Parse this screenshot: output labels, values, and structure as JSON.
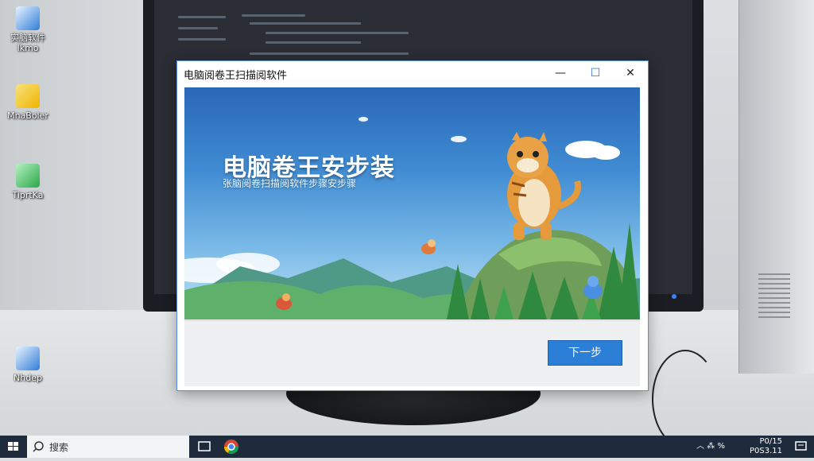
{
  "desktop": {
    "icons": [
      {
        "label": "实脑软件\nIkmo"
      },
      {
        "label": "MnaBoler"
      },
      {
        "label": "TiprtKa"
      },
      {
        "label": "Nhdep"
      }
    ]
  },
  "window": {
    "title": "电脑阅卷王扫描阅软件",
    "controls": {
      "minimize": "—",
      "maximize": "☐",
      "close": "✕"
    },
    "banner": {
      "title": "电脑卷王安步装",
      "subtitle": "张脑阅卷扫描阅软件步骤安步骤"
    },
    "next_label": "下一步"
  },
  "taskbar": {
    "search_placeholder": "搜索",
    "clock_line1": "P0/15",
    "clock_line2": "P0S3.11"
  },
  "colors": {
    "accent": "#2c7fd6",
    "window_border": "#5a8fd8",
    "taskbar": "#1e2b3d"
  }
}
